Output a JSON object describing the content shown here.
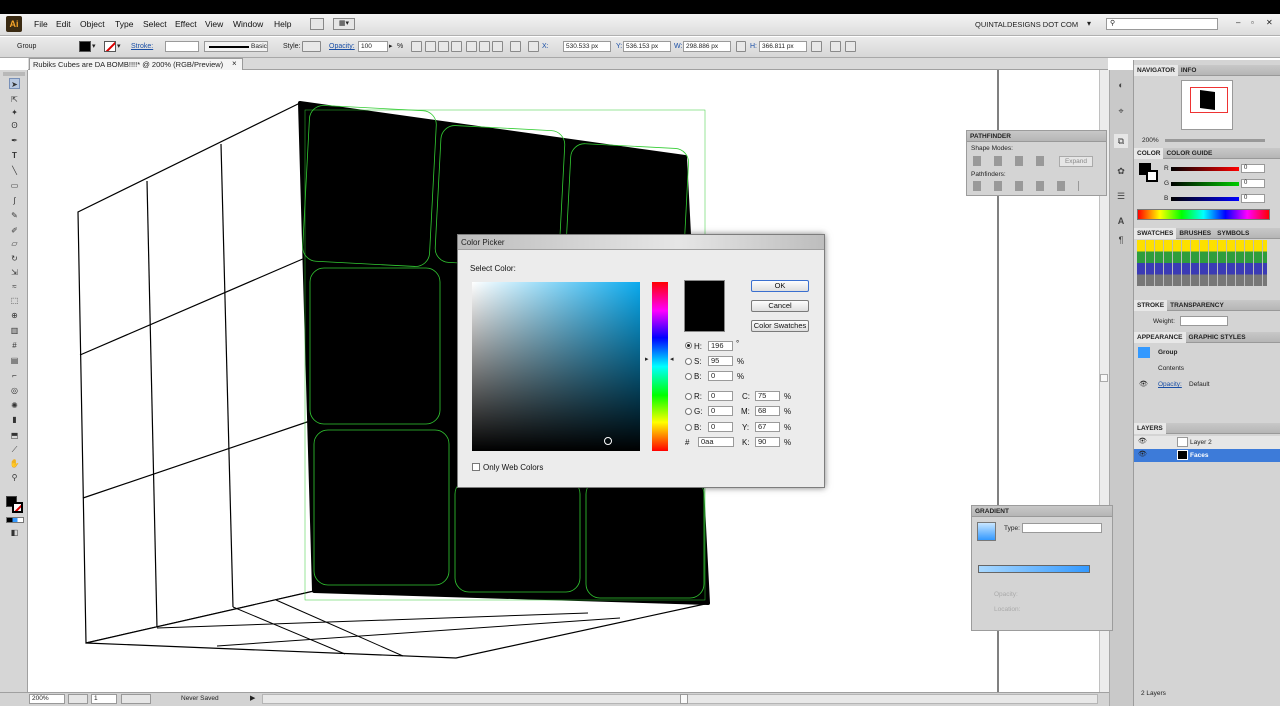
{
  "app": {
    "logo": "Ai",
    "brand_menu": "QUINTALDESIGNS DOT COM",
    "search_placeholder": ""
  },
  "menu": [
    "File",
    "Edit",
    "Object",
    "Type",
    "Select",
    "Effect",
    "View",
    "Window",
    "Help"
  ],
  "control_bar": {
    "selection": "Group",
    "stroke_label": "Stroke:",
    "stroke_style": "Basic",
    "style_label": "Style:",
    "opacity_label": "Opacity:",
    "opacity_value": "100",
    "opacity_unit": "%",
    "x_label": "X:",
    "x_value": "530.533 px",
    "y_label": "Y:",
    "y_value": "536.153 px",
    "w_label": "W:",
    "w_value": "298.886 px",
    "h_label": "H:",
    "h_value": "366.811 px"
  },
  "document": {
    "tab_title": "Rubiks Cubes are DA BOMB!!!!* @ 200% (RGB/Preview)",
    "close": "×"
  },
  "status": {
    "zoom": "200%",
    "page": "1",
    "save_state": "Never Saved"
  },
  "color_picker": {
    "title": "Color Picker",
    "select_label": "Select Color:",
    "ok": "OK",
    "cancel": "Cancel",
    "swatches": "Color Swatches",
    "h_label": "H:",
    "h_value": "196",
    "h_unit": "°",
    "s_label": "S:",
    "s_value": "95",
    "s_unit": "%",
    "b_label": "B:",
    "b_value": "0",
    "b_unit": "%",
    "r_label": "R:",
    "r_value": "0",
    "g_label": "G:",
    "g_value": "0",
    "bb_label": "B:",
    "bb_value": "0",
    "hex_label": "#",
    "hex_value": "0aa",
    "c_label": "C:",
    "c_value": "75",
    "m_label": "M:",
    "m_value": "68",
    "y_label": "Y:",
    "y_value": "67",
    "k_label": "K:",
    "k_value": "90",
    "pct": "%",
    "web_only": "Only Web Colors",
    "preview_color": "#000000"
  },
  "navigator": {
    "tab1": "NAVIGATOR",
    "tab2": "INFO",
    "zoom": "200%"
  },
  "pathfinder": {
    "title": "PATHFINDER",
    "shape_modes": "Shape Modes:",
    "expand": "Expand",
    "pathfinders": "Pathfinders:"
  },
  "color_panel": {
    "tab1": "COLOR",
    "tab2": "COLOR GUIDE",
    "r_label": "R",
    "r_value": "0",
    "g_label": "G",
    "g_value": "0",
    "b_label": "B",
    "b_value": "0"
  },
  "swatches": {
    "tab1": "SWATCHES",
    "tab2": "BRUSHES",
    "tab3": "SYMBOLS"
  },
  "stroke": {
    "tab1": "STROKE",
    "tab2": "TRANSPARENCY",
    "weight_label": "Weight:"
  },
  "appearance": {
    "tab1": "APPEARANCE",
    "tab2": "GRAPHIC STYLES",
    "group": "Group",
    "contents": "Contents",
    "opacity_label": "Opacity:",
    "opacity_value": "Default"
  },
  "layers": {
    "title": "LAYERS",
    "layer1": "Layer 2",
    "layer2": "Faces",
    "count": "2 Layers"
  },
  "gradient": {
    "title": "GRADIENT",
    "type_label": "Type:",
    "opacity_label": "Opacity:",
    "location_label": "Location:"
  },
  "colors": {
    "accent": "#3399ff",
    "selection_green": "#33cc33",
    "spectrum_hue": "#0aaaee"
  }
}
